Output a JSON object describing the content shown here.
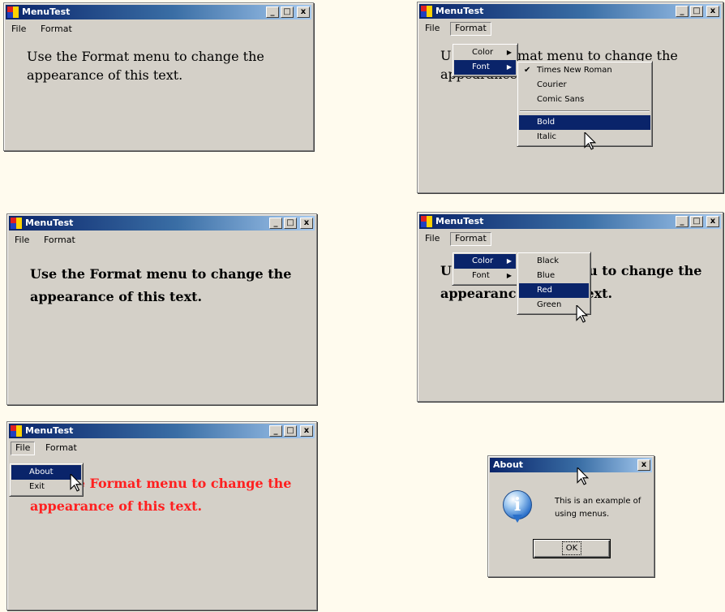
{
  "window_title": "MenuTest",
  "about_title": "About",
  "controls": {
    "minimize": "_",
    "maximize": "□",
    "close": "x"
  },
  "menus": {
    "file": "File",
    "format": "Format"
  },
  "body_text": "Use the Format menu to change the appearance of this text.",
  "font_menu": {
    "items": [
      "Times New Roman",
      "Courier",
      "Comic Sans"
    ],
    "styles": [
      "Bold",
      "Italic"
    ],
    "checked_index": 0,
    "highlight": "Bold"
  },
  "format_menu": {
    "color": "Color",
    "font": "Font",
    "arrow": "▶"
  },
  "color_menu": {
    "items": [
      "Black",
      "Blue",
      "Red",
      "Green"
    ],
    "highlight": "Red"
  },
  "file_menu": {
    "items": [
      "About",
      "Exit"
    ],
    "highlight": "About"
  },
  "about_dialog": {
    "message": "This is an example of using menus.",
    "ok_label": "OK",
    "close": "x"
  },
  "colors": {
    "titlebar_start": "#0a246a",
    "titlebar_end": "#a6caf0",
    "face": "#d4d0c8",
    "red_text": "#ff2020",
    "highlight": "#0a246a"
  }
}
